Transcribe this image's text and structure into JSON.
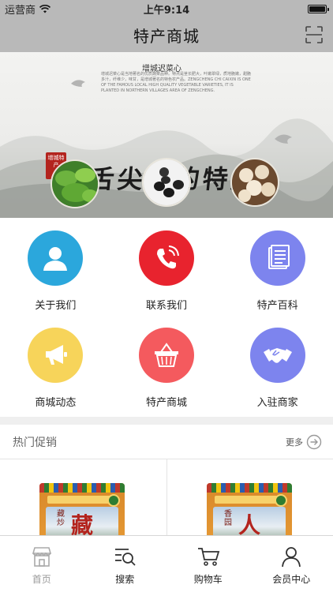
{
  "status_bar": {
    "carrier": "运营商",
    "time": "上午9:14"
  },
  "nav": {
    "title": "特产商城",
    "right_icon": "scan-icon"
  },
  "banner": {
    "small_title": "增城迟菜心",
    "description": "增城迟菜心是当地著名的优质蔬菜品种。特点是茎长肥大，叶嫩翠绿，质地脆嫩，甜脆多汁，纤维少，味甘，是增城著名的特色农产品。ZENGCHENG CHI CAIXIN IS ONE OF THE FAMOUS LOCAL HIGH QUALITY VEGETABLE VARIETIES, IT IS PLANTED IN NORTHERN VILLAGES AREA OF ZENGCHENG.",
    "seal_text": "增城特产",
    "main_title": "舌尖上的特產"
  },
  "menu": [
    {
      "label": "关于我们",
      "icon": "user-icon",
      "color": "#2ba7dc"
    },
    {
      "label": "联系我们",
      "icon": "phone-icon",
      "color": "#e8232e"
    },
    {
      "label": "特产百科",
      "icon": "document-icon",
      "color": "#7d84ee"
    },
    {
      "label": "商城动态",
      "icon": "megaphone-icon",
      "color": "#f7d45a"
    },
    {
      "label": "特产商城",
      "icon": "basket-icon",
      "color": "#f45a5e"
    },
    {
      "label": "入驻商家",
      "icon": "handshake-icon",
      "color": "#7d84ee"
    }
  ],
  "promo": {
    "title": "热门促销",
    "more_label": "更多"
  },
  "products": [
    {
      "pack_char": "藏",
      "pack_small": "藏炒"
    },
    {
      "pack_char": "人",
      "pack_small": "香园"
    }
  ],
  "tabs": [
    {
      "label": "首页",
      "icon": "shop-icon",
      "active": true
    },
    {
      "label": "搜索",
      "icon": "search-list-icon"
    },
    {
      "label": "购物车",
      "icon": "cart-icon"
    },
    {
      "label": "会员中心",
      "icon": "person-icon"
    }
  ],
  "colors": {
    "nav_bg": "#b9b9b9",
    "divider": "#efefef",
    "tab_inactive": "#9a9a9a"
  }
}
